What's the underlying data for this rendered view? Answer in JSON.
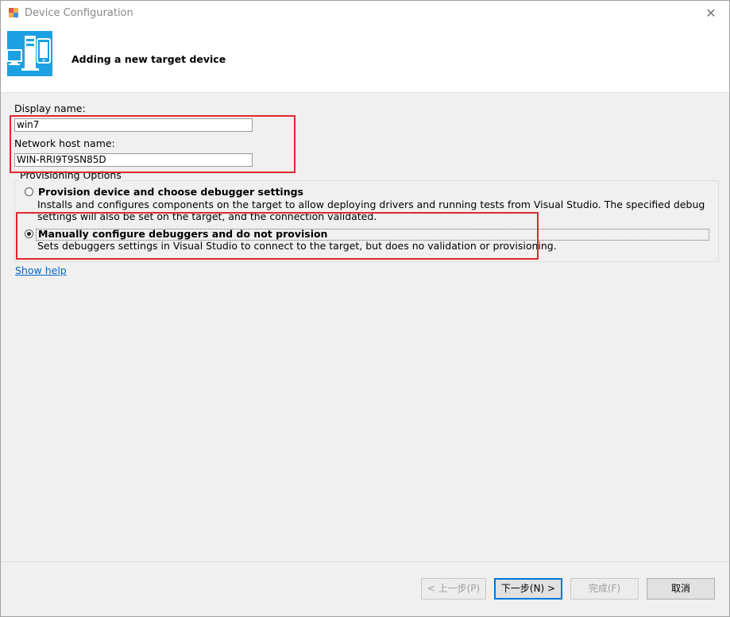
{
  "window": {
    "title": "Device Configuration",
    "close_glyph": "✕"
  },
  "header": {
    "title": "Adding a new target device"
  },
  "form": {
    "display_name_label": "Display name:",
    "display_name_value": "win7",
    "host_name_label": "Network host name:",
    "host_name_value": "WIN-RRI9T9SN85D"
  },
  "provisioning": {
    "group_title": "Provisioning Options",
    "options": [
      {
        "title": "Provision device and choose debugger settings",
        "description": "Installs and configures components on the target to allow deploying drivers and running tests from Visual Studio. The specified debug settings will also be set on the target, and the connection validated.",
        "selected": false
      },
      {
        "title": "Manually configure debuggers and do not provision",
        "description": "Sets debuggers settings in Visual Studio to connect to the target, but does no validation or provisioning.",
        "selected": true
      }
    ]
  },
  "help_link": "Show help",
  "buttons": {
    "back": "< 上一步(P)",
    "next": "下一步(N) >",
    "finish": "完成(F)",
    "cancel": "取消"
  },
  "colors": {
    "accent": "#1ba1e2",
    "highlight_box": "#e3262c",
    "link": "#0066cc"
  }
}
